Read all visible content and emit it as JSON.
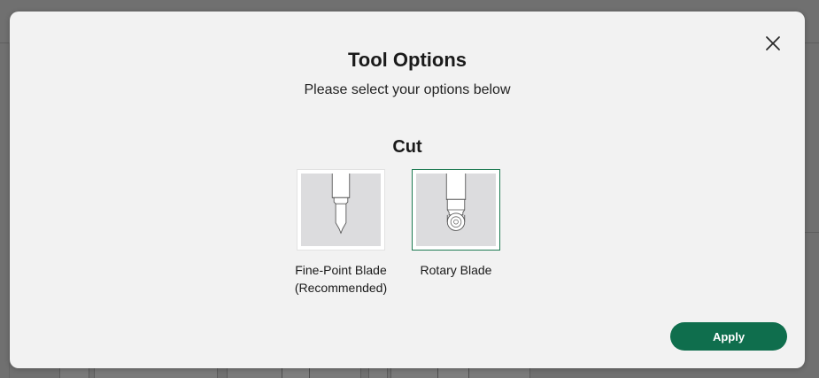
{
  "modal": {
    "title": "Tool Options",
    "subtitle": "Please select your options below",
    "close_icon": "close-icon",
    "section_title": "Cut",
    "options": [
      {
        "label_line1": "Fine-Point Blade",
        "label_line2": "(Recommended)",
        "icon": "fine-point-blade-icon",
        "selected": false
      },
      {
        "label_line1": "Rotary Blade",
        "label_line2": "",
        "icon": "rotary-blade-icon",
        "selected": true
      }
    ],
    "apply_label": "Apply"
  },
  "colors": {
    "accent": "#0f6e4d",
    "selected_border": "#1d7a52",
    "modal_background": "#f2f2f2",
    "overlay": "#707070"
  }
}
